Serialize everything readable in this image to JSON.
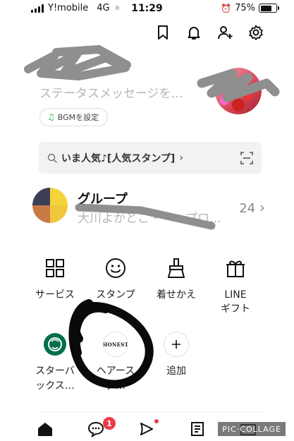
{
  "status_bar": {
    "carrier": "Y!mobile",
    "network": "4G",
    "time": "11:29",
    "battery_percent": "75%",
    "battery_level": 0.75
  },
  "header": {
    "icons": [
      "bookmark-icon",
      "bell-icon",
      "add-friend-icon",
      "settings-icon"
    ]
  },
  "profile": {
    "status_message_placeholder": "ステータスメッセージを…",
    "bgm_label": "BGMを設定"
  },
  "search": {
    "text": "いま人気♪[人気スタンプ]"
  },
  "group": {
    "title": "グループ",
    "subtitle": "大川よかとこ・・・プロ…",
    "count": "24"
  },
  "services": [
    {
      "label": "サービス",
      "icon": "grid-icon"
    },
    {
      "label": "スタンプ",
      "icon": "smiley-icon"
    },
    {
      "label": "着せかえ",
      "icon": "brush-icon"
    },
    {
      "label": "LINE\nギフト",
      "icon": "gift-icon"
    }
  ],
  "shortcuts": [
    {
      "label": "スターバックス…",
      "label_line1": "スターバ",
      "label_line2": "ックス…",
      "icon": "starbucks-logo"
    },
    {
      "label": "ヘアース",
      "label_line2": "ダ…",
      "icon": "honest-logo",
      "logo_text": "HONEST"
    },
    {
      "label": "追加",
      "icon": "plus-icon"
    }
  ],
  "bottom_nav": {
    "items": [
      "home-icon",
      "chat-icon",
      "voom-icon",
      "news-icon",
      "wallet-icon"
    ],
    "chat_badge": "1"
  },
  "watermark": "PIC·COLLAGE",
  "colors": {
    "accent_green": "#2db34a",
    "badge_red": "#ea3b47",
    "placeholder_gray": "#b5b5b5"
  }
}
